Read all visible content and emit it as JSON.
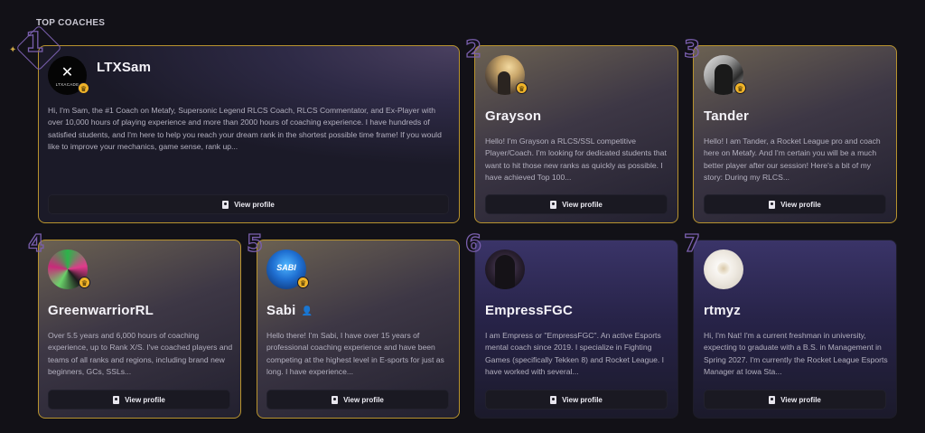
{
  "section": {
    "title": "TOP COACHES"
  },
  "button_label": "View profile",
  "coaches": [
    {
      "rank": "1",
      "name": "LTXSam",
      "bio": "Hi, I'm Sam, the #1 Coach on Metafy, Supersonic Legend RLCS Coach, RLCS Commentator, and Ex-Player with over 10,000 hours of playing experience and more than 2000 hours of coaching experience. I have hundreds of satisfied students, and I'm here to help you reach your dream rank in the shortest possible time frame! If you would like to improve your mechanics, game sense, rank up...",
      "avatar_text": "LTXACADE"
    },
    {
      "rank": "2",
      "name": "Grayson",
      "bio": "Hello! I'm Grayson a RLCS/SSL competitive Player/Coach. I'm looking for dedicated students that want to hit those new ranks as quickly as possible. I have achieved Top 100..."
    },
    {
      "rank": "3",
      "name": "Tander",
      "bio": "Hello! I am Tander, a Rocket League pro and coach here on Metafy. And I'm certain you will be a much better player after our session! Here's a bit of my story: During my RLCS..."
    },
    {
      "rank": "4",
      "name": "GreenwarriorRL",
      "bio": "Over 5.5 years and 6,000 hours of coaching experience, up to Rank X/S. I've coached players and teams of all ranks and regions, including brand new beginners, GCs, SSLs..."
    },
    {
      "rank": "5",
      "name": "Sabi",
      "bio": "Hello there! I'm Sabi, I have over 15 years of professional coaching experience and have been competing at the highest level in E-sports for just as long. I have experience...",
      "avatar_text": "SABI"
    },
    {
      "rank": "6",
      "name": "EmpressFGC",
      "bio": "I am Empress or \"EmpressFGC\". An active Esports mental coach since 2019. I specialize in Fighting Games (specifically Tekken 8) and Rocket League. I have worked with several..."
    },
    {
      "rank": "7",
      "name": "rtmyz",
      "bio": "Hi, I'm Nat! I'm a current freshman in university, expecting to graduate with a B.S. in Management in Spring 2027. I'm currently the Rocket League Esports Manager at Iowa Sta..."
    }
  ]
}
